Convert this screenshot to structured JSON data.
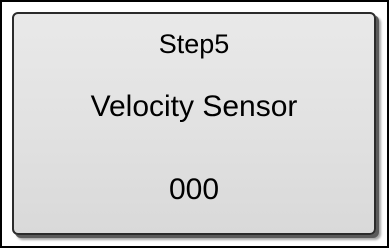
{
  "step": {
    "title": "Step5",
    "sensor_name": "Velocity Sensor",
    "value": "000"
  }
}
